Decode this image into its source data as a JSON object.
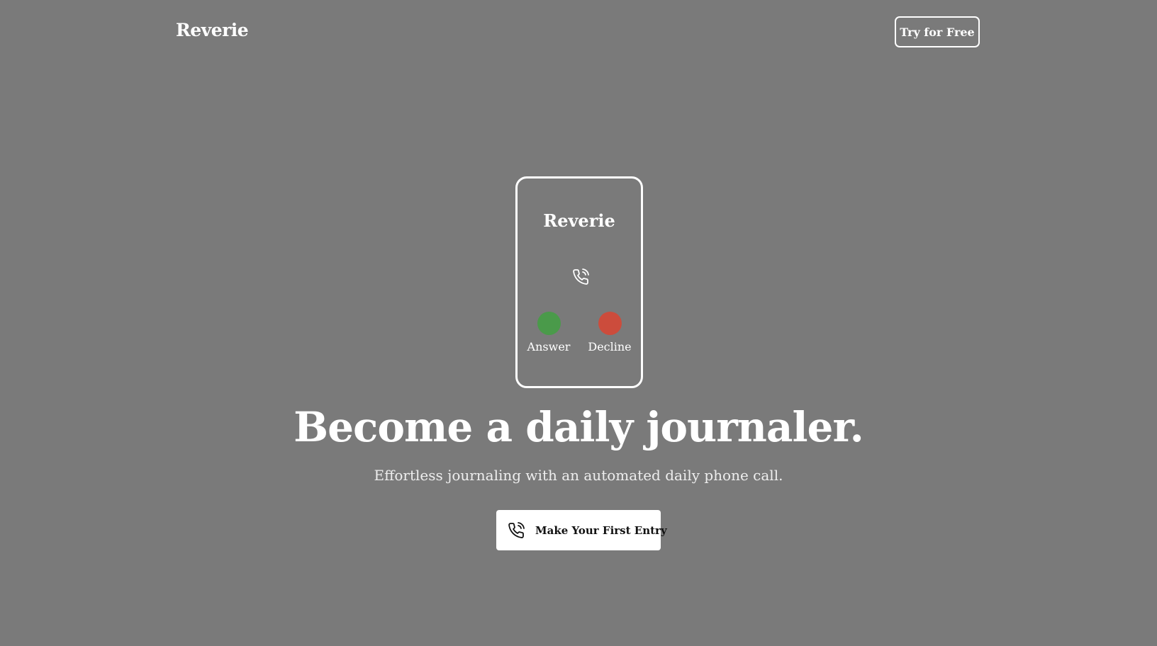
{
  "header": {
    "brand": "Reverie",
    "try_button_label": "Try for Free"
  },
  "phone_mock": {
    "title": "Reverie",
    "icon": "phone-call-icon",
    "answer": {
      "label": "Answer",
      "color": "#4a9a4a"
    },
    "decline": {
      "label": "Decline",
      "color": "#cc4c3c"
    }
  },
  "hero": {
    "headline": "Become a daily journaler.",
    "subheadline": "Effortless journaling with an automated daily phone call.",
    "cta_label": "Make Your First Entry",
    "cta_icon": "phone-call-icon"
  },
  "colors": {
    "background": "#7a7a7a",
    "text": "#ffffff",
    "button_background": "#ffffff",
    "button_text": "#111111"
  }
}
